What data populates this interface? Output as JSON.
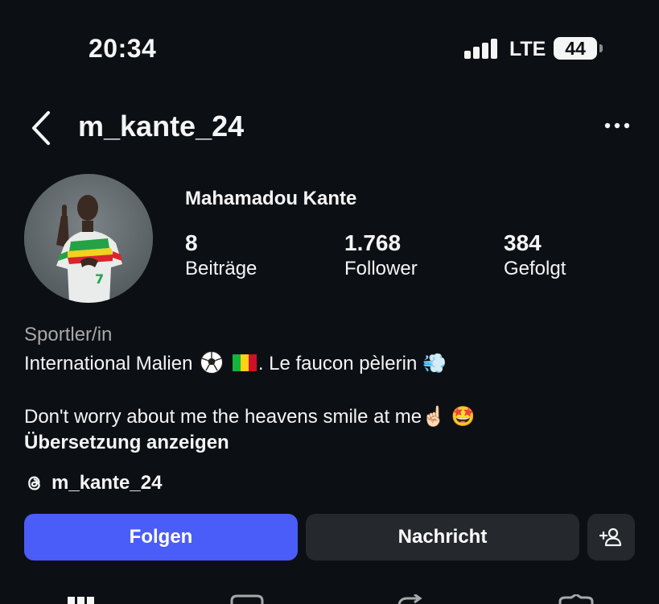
{
  "status_bar": {
    "time": "20:34",
    "network": "LTE",
    "battery": "44"
  },
  "nav": {
    "username": "m_kante_24"
  },
  "profile": {
    "full_name": "Mahamadou Kante",
    "stats": [
      {
        "value": "8",
        "label": "Beiträge"
      },
      {
        "value": "1.768",
        "label": "Follower"
      },
      {
        "value": "384",
        "label": "Gefolgt"
      }
    ],
    "category": "Sportler/in",
    "bio_line1_a": "International Malien",
    "bio_line1_b": ". Le faucon pèlerin",
    "bio_line2": "Don't worry about me the heavens smile at me",
    "emoji_dash": "💨",
    "emoji_point": "☝🏻",
    "emoji_star": "🤩",
    "translate_label": "Übersetzung anzeigen",
    "threads_handle": "m_kante_24"
  },
  "actions": {
    "follow_label": "Folgen",
    "message_label": "Nachricht",
    "add_icon": "add-person-icon"
  },
  "tabs": [
    "grid-icon",
    "reels-icon",
    "reposts-icon",
    "tagged-icon"
  ],
  "colors": {
    "background": "#0c1014",
    "follow_button": "#4a5df9",
    "secondary_button": "#25292e",
    "muted_text": "#a8a8a8"
  }
}
